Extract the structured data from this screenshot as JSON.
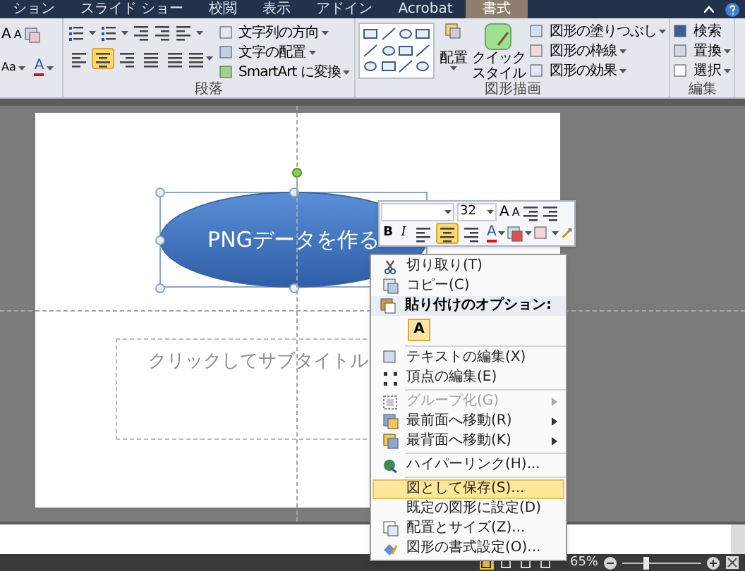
{
  "ribbon_tabs": [
    {
      "label": "ション",
      "selected": false
    },
    {
      "label": "スライド ショー",
      "selected": false
    },
    {
      "label": "校閲",
      "selected": false
    },
    {
      "label": "表示",
      "selected": false
    },
    {
      "label": "アドイン",
      "selected": false
    },
    {
      "label": "Acrobat",
      "selected": false
    },
    {
      "label": "書式",
      "selected": true
    }
  ],
  "font_group": {
    "grow": "A",
    "shrink": "A",
    "change_case": "Aa",
    "font_color": "A"
  },
  "paragraph_group": {
    "label": "段落",
    "alignment": [
      {
        "selected": false
      },
      {
        "selected": true
      },
      {
        "selected": false
      },
      {
        "selected": false
      },
      {
        "selected": false
      }
    ],
    "commands": [
      "文字列の方向",
      "文字の配置",
      "SmartArt に変換"
    ]
  },
  "drawing_group": {
    "label": "図形描画",
    "arrange": "配置",
    "quick_style": [
      "クイック",
      "スタイル"
    ],
    "commands": [
      "図形の塗りつぶし",
      "図形の枠線",
      "図形の効果"
    ]
  },
  "editing_group": {
    "label": "編集",
    "commands": [
      "検索",
      "置換",
      "選択"
    ]
  },
  "slide": {
    "shape_text": "PNGデータを作る",
    "subtitle_placeholder": "クリックしてサブタイトル"
  },
  "mini_toolbar": {
    "font_size": "32",
    "grow": "A",
    "shrink": "A",
    "bold": "B",
    "italic": "I",
    "alignment": [
      {
        "selected": false
      },
      {
        "selected": true
      },
      {
        "selected": false
      }
    ],
    "font_color": "A"
  },
  "context_menu": [
    {
      "kind": "command",
      "label": "切り取り(T)",
      "disabled": false,
      "selected": false,
      "submenu": false
    },
    {
      "kind": "command",
      "label": "コピー(C)",
      "disabled": false,
      "selected": false,
      "submenu": false
    },
    {
      "kind": "header",
      "label": "貼り付けのオプション:"
    },
    {
      "kind": "paste_option",
      "label": "A"
    },
    {
      "kind": "separator"
    },
    {
      "kind": "command",
      "label": "テキストの編集(X)",
      "disabled": false,
      "selected": false,
      "submenu": false
    },
    {
      "kind": "command",
      "label": "頂点の編集(E)",
      "disabled": false,
      "selected": false,
      "submenu": false
    },
    {
      "kind": "separator"
    },
    {
      "kind": "command",
      "label": "グループ化(G)",
      "disabled": true,
      "selected": false,
      "submenu": true
    },
    {
      "kind": "command",
      "label": "最前面へ移動(R)",
      "disabled": false,
      "selected": false,
      "submenu": true
    },
    {
      "kind": "command",
      "label": "最背面へ移動(K)",
      "disabled": false,
      "selected": false,
      "submenu": true
    },
    {
      "kind": "separator"
    },
    {
      "kind": "command",
      "label": "ハイパーリンク(H)...",
      "disabled": false,
      "selected": false,
      "submenu": false
    },
    {
      "kind": "separator"
    },
    {
      "kind": "command",
      "label": "図として保存(S)...",
      "disabled": false,
      "selected": true,
      "submenu": false
    },
    {
      "kind": "command",
      "label": "既定の図形に設定(D)",
      "disabled": false,
      "selected": false,
      "submenu": false
    },
    {
      "kind": "command",
      "label": "配置とサイズ(Z)...",
      "disabled": false,
      "selected": false,
      "submenu": false
    },
    {
      "kind": "command",
      "label": "図形の書式設定(O)...",
      "disabled": false,
      "selected": false,
      "submenu": false
    }
  ],
  "status_bar": {
    "views": [
      {
        "selected": true
      },
      {
        "selected": false
      },
      {
        "selected": false
      },
      {
        "selected": false
      }
    ],
    "zoom": "65%",
    "zoom_slider": {
      "level": 0.3
    }
  }
}
